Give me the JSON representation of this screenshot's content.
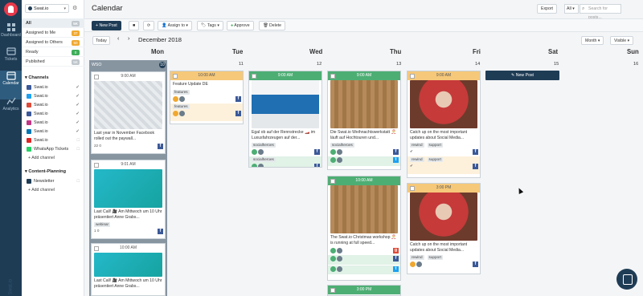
{
  "app": {
    "title": "Calendar",
    "account": "Swat.io"
  },
  "rail": [
    {
      "label": "Dashboard",
      "icon": "dashboard-icon"
    },
    {
      "label": "Tickets",
      "icon": "tickets-icon"
    },
    {
      "label": "Calendar",
      "icon": "calendar-icon"
    },
    {
      "label": "Analytics",
      "icon": "analytics-icon"
    }
  ],
  "filters": [
    {
      "label": "All",
      "count": "5K"
    },
    {
      "label": "Assigned to Me",
      "count": "37"
    },
    {
      "label": "Assigned to Others",
      "count": "50"
    },
    {
      "label": "Ready",
      "count": "0"
    },
    {
      "label": "Published",
      "count": "5K"
    }
  ],
  "channels_title": "Channels",
  "channels": [
    {
      "label": "Swat.io",
      "color": "#3b5998"
    },
    {
      "label": "Swat.io",
      "color": "#1da1f2"
    },
    {
      "label": "Swat.io",
      "color": "#dd4b39"
    },
    {
      "label": "Swat.io",
      "color": "#3b5998"
    },
    {
      "label": "Swat.io",
      "color": "#c13584"
    },
    {
      "label": "Swat.io",
      "color": "#0077b5"
    },
    {
      "label": "Swat.io",
      "color": "#e02424"
    },
    {
      "label": "WhatsApp Tickets",
      "color": "#25d366"
    }
  ],
  "add_channel": "Add channel",
  "content_planning_title": "Content-Planning",
  "content_planning": [
    {
      "label": "Newsletter",
      "color": "#1f3c55"
    }
  ],
  "toolbar": {
    "export": "Export",
    "filter_all": "All",
    "search_placeholder": "Search for posts..."
  },
  "actions": {
    "new_post": "New Post",
    "assign_to": "Assign to",
    "tags": "Tags",
    "approve": "Approve",
    "delete": "Delete"
  },
  "nav": {
    "today": "Today",
    "month_label": "December 2018",
    "view": "Month",
    "visible": "Visible"
  },
  "days": [
    {
      "name": "Mon",
      "num": "WSO"
    },
    {
      "name": "Tue",
      "num": "11"
    },
    {
      "name": "Wed",
      "num": "12"
    },
    {
      "name": "Thu",
      "num": "13"
    },
    {
      "name": "Fri",
      "num": "14"
    },
    {
      "name": "Sat",
      "num": "15"
    },
    {
      "name": "Sun",
      "num": "16"
    }
  ],
  "wso_badge": "10",
  "sat_new_post": "New Post",
  "posts": {
    "mon1": {
      "time": "9:00 AM",
      "text": "Last year in November Facebook rolled out the paywall...",
      "stats": "22  0"
    },
    "mon2": {
      "time": "9:01 AM",
      "text": "Last Call! 🎥 Am Mittwoch um 10 Uhr präsentiert Anne Grabs...",
      "tag": "webinar",
      "stats": "1  0"
    },
    "mon3": {
      "time": "10:00 AM",
      "text": "Last Call! 🎥 Am Mittwoch um 10 Uhr präsentiert Anne Grabs..."
    },
    "tue1": {
      "time": "10:00 AM",
      "text": "Feature Update DE",
      "tag": "features"
    },
    "tue2": {
      "tag": "features"
    },
    "wed1": {
      "time": "9:00 AM",
      "text": "Egal ob auf der Rennstrecke 🏎️ im Luxusfahrzeugen auf der...",
      "tag": "socialheroes"
    },
    "wed2": {
      "tag": "socialheroes"
    },
    "thu1": {
      "time": "9:00 AM",
      "text": "Die Swat.io Weihnachtswerkstatt 🎅 läuft auf Hochtouren und...",
      "tag": "socialheroes"
    },
    "thu2": {
      "time": "10:00 AM",
      "text": "The Swat.io Christmas workshop 🎅 is running at full speed..."
    },
    "thu3": {
      "time": "3:00 PM"
    },
    "fri1": {
      "time": "9:00 AM",
      "text": "Catch up on the most important updates about Social Media...",
      "tags": [
        "rewind",
        "support"
      ]
    },
    "fri2": {
      "tags": [
        "rewind",
        "support"
      ]
    },
    "fri3": {
      "time": "3:00 PM",
      "text": "Catch up on the most important updates about Social Media...",
      "tags": [
        "rewind",
        "support"
      ]
    }
  }
}
